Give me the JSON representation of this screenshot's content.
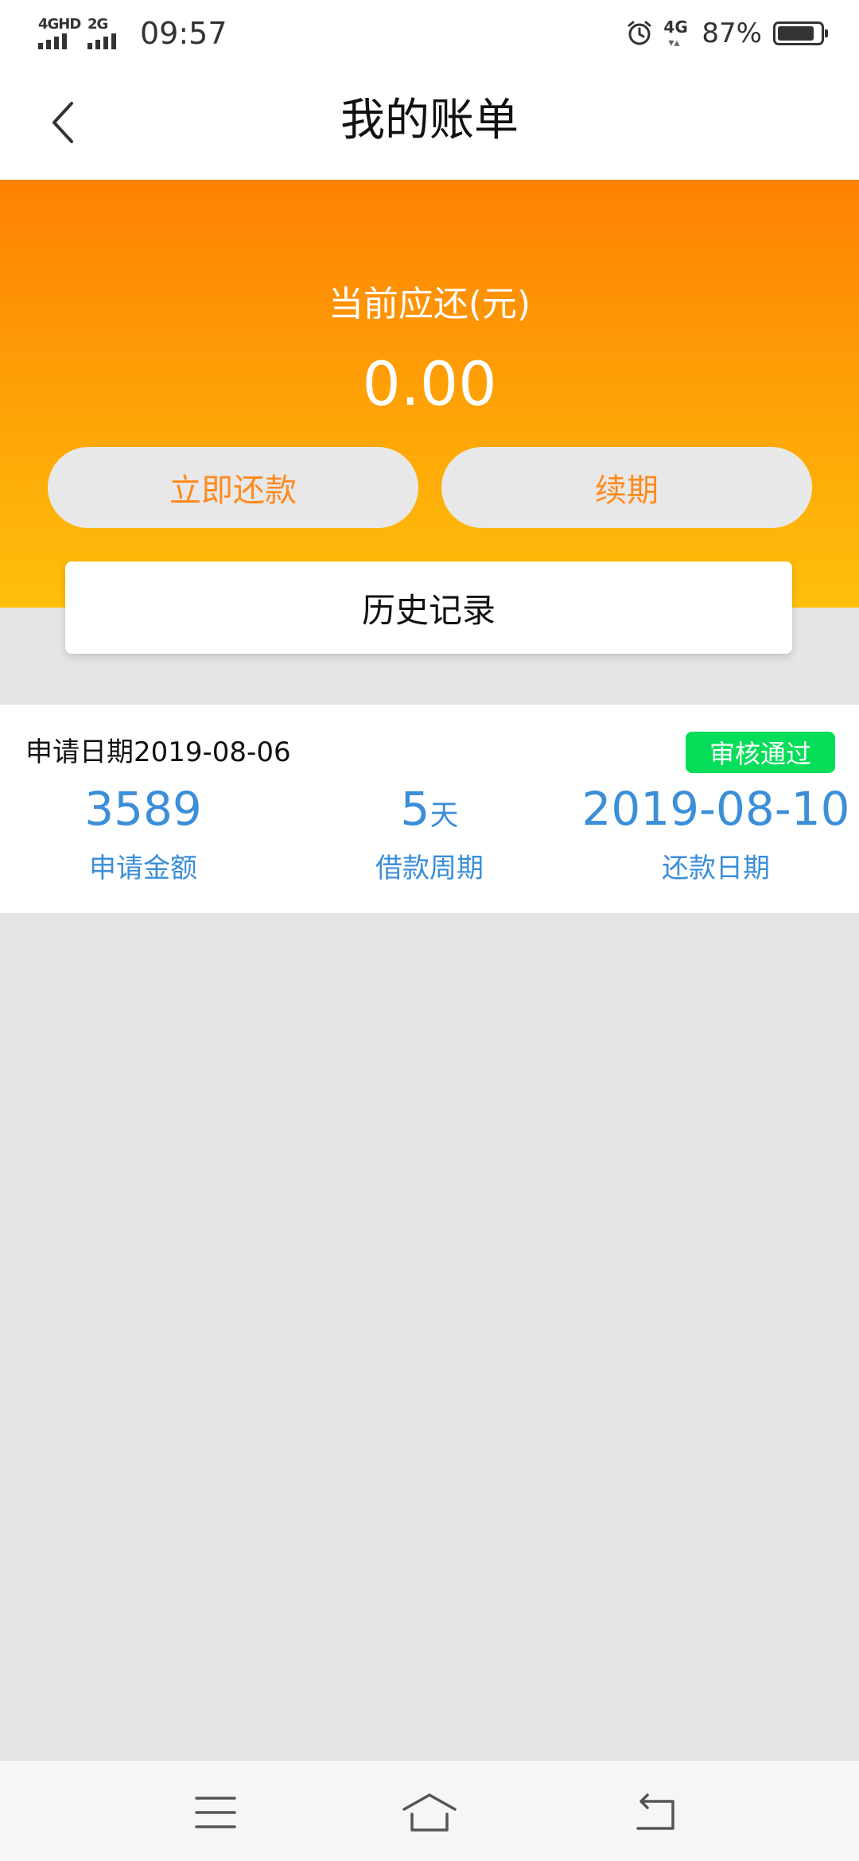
{
  "status_bar": {
    "signal1_label": "4GHD",
    "signal2_label": "2G",
    "time": "09:57",
    "net_label": "4G",
    "battery": "87%",
    "battery_level": 0.87
  },
  "header": {
    "title": "我的账单"
  },
  "hero": {
    "label": "当前应还(元)",
    "amount": "0.00",
    "repay_button": "立即还款",
    "renew_button": "续期",
    "history_button": "历史记录"
  },
  "record": {
    "apply_date": "申请日期2019-08-06",
    "status": "审核通过",
    "amount_value": "3589",
    "amount_label": "申请金额",
    "period_value": "5",
    "period_unit": "天",
    "period_label": "借款周期",
    "due_value": "2019-08-10",
    "due_label": "还款日期"
  },
  "colors": {
    "accent_orange": "#ff8a1e",
    "status_green": "#06de5a",
    "value_blue": "#3b8ed8"
  },
  "icons": {
    "back": "chevron-left-icon",
    "menu": "menu-icon",
    "home": "home-icon",
    "nav_back": "return-icon",
    "alarm": "alarm-icon",
    "battery": "battery-icon"
  }
}
